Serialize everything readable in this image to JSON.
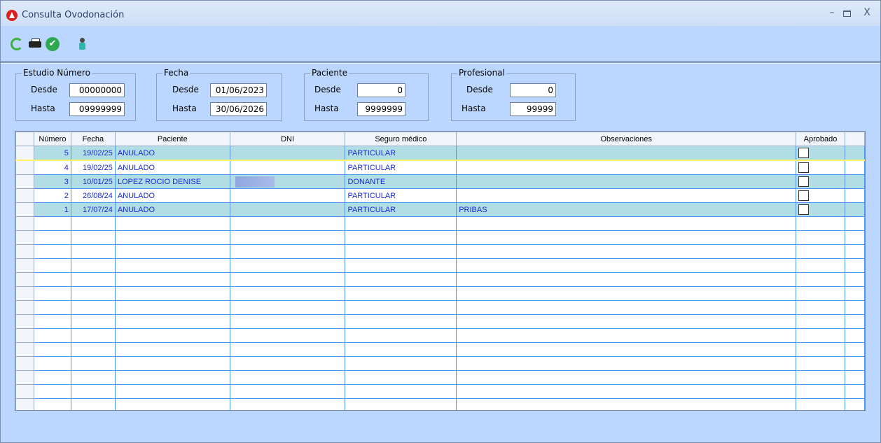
{
  "window": {
    "title": "Consulta Ovodonación",
    "controls": {
      "minimize": "–",
      "close": "X"
    }
  },
  "toolbar": {
    "items": [
      {
        "icon": "refresh-icon"
      },
      {
        "icon": "print-icon"
      },
      {
        "icon": "approve-check-icon"
      },
      {
        "icon": "person-icon"
      }
    ]
  },
  "filters": {
    "estudio": {
      "title": "Estudio Número",
      "desde_label": "Desde",
      "desde": "00000000",
      "hasta_label": "Hasta",
      "hasta": "09999999"
    },
    "fecha": {
      "title": "Fecha",
      "desde_label": "Desde",
      "desde": "01/06/2023",
      "hasta_label": "Hasta",
      "hasta": "30/06/2026"
    },
    "paciente": {
      "title": "Paciente",
      "desde_label": "Desde",
      "desde": "0",
      "hasta_label": "Hasta",
      "hasta": "9999999"
    },
    "profesional": {
      "title": "Profesional",
      "desde_label": "Desde",
      "desde": "0",
      "hasta_label": "Hasta",
      "hasta": "99999"
    }
  },
  "grid": {
    "columns": [
      "Número",
      "Fecha",
      "Paciente",
      "DNI",
      "Seguro médico",
      "Observaciones",
      "Aprobado"
    ],
    "rows": [
      {
        "numero": "5",
        "fecha": "19/02/25",
        "paciente": "ANULADO",
        "dni": "",
        "seguro": "PARTICULAR",
        "observaciones": "",
        "aprobado": false
      },
      {
        "numero": "4",
        "fecha": "19/02/25",
        "paciente": "ANULADO",
        "dni": "",
        "seguro": "PARTICULAR",
        "observaciones": "",
        "aprobado": false
      },
      {
        "numero": "3",
        "fecha": "10/01/25",
        "paciente": "LOPEZ ROCIO DENISE",
        "dni": "",
        "seguro": "DONANTE",
        "observaciones": "",
        "aprobado": false
      },
      {
        "numero": "2",
        "fecha": "26/08/24",
        "paciente": "ANULADO",
        "dni": "",
        "seguro": "PARTICULAR",
        "observaciones": "",
        "aprobado": false
      },
      {
        "numero": "1",
        "fecha": "17/07/24",
        "paciente": "ANULADO",
        "dni": "",
        "seguro": "PARTICULAR",
        "observaciones": "PRIBAS",
        "aprobado": false
      }
    ],
    "empty_rows": 14
  },
  "colors": {
    "window_bg": "#bcd7ff",
    "grid_line": "#4d97ea",
    "row_highlight": "#b2dde5",
    "text_blue": "#1a2bd6"
  }
}
